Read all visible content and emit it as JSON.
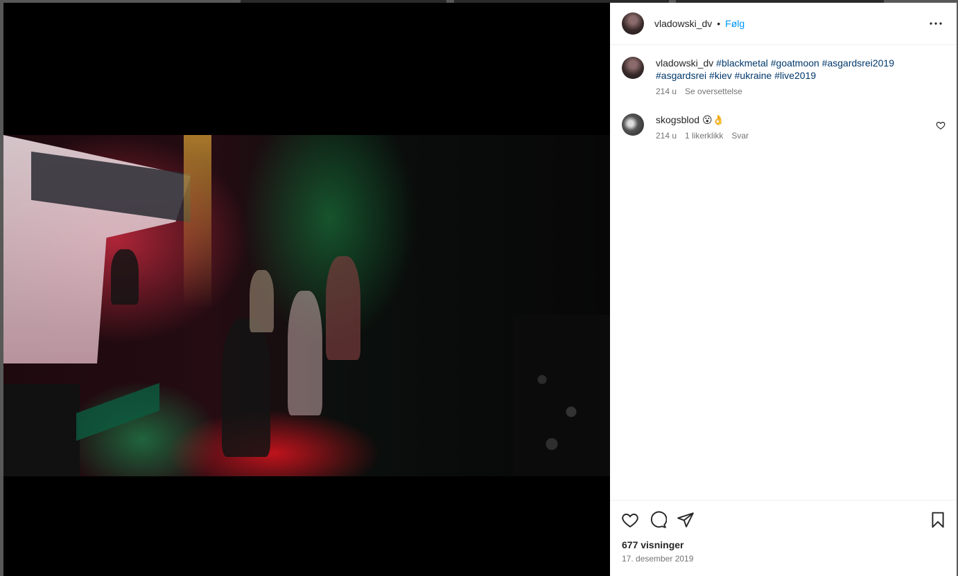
{
  "post": {
    "author": "vladowski_dv",
    "follow_label": "Følg",
    "dot": "•",
    "more_icon": "more-horizontal-icon"
  },
  "caption": {
    "author": "vladowski_dv",
    "hashtags": [
      "#blackmetal",
      "#goatmoon",
      "#asgardsrei2019",
      "#asgardsrei",
      "#kiev",
      "#ukraine",
      "#live2019"
    ],
    "time": "214 u",
    "translate_label": "Se oversettelse"
  },
  "comments": [
    {
      "author": "skogsblod",
      "text": "😮👌",
      "time": "214 u",
      "likes": "1 likerklikk",
      "reply_label": "Svar"
    }
  ],
  "actions": {
    "like_icon": "heart-icon",
    "comment_icon": "comment-icon",
    "share_icon": "paper-plane-icon",
    "save_icon": "bookmark-icon"
  },
  "stats": {
    "views": "677 visninger",
    "date": "17. desember 2019"
  },
  "media": {
    "mute_icon": "speaker-muted-icon"
  }
}
